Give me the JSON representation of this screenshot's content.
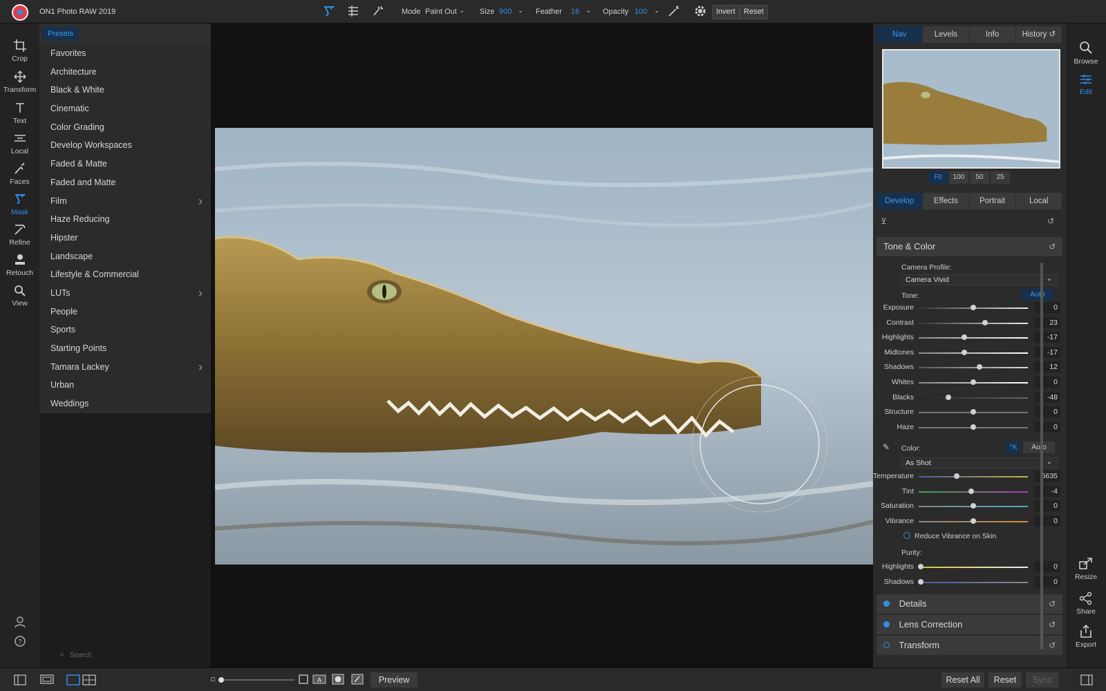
{
  "app": {
    "title": "ON1 Photo RAW 2019"
  },
  "toolbar": {
    "mode_label": "Mode",
    "mode_value": "Paint Out",
    "size_label": "Size",
    "size_value": "900",
    "feather_label": "Feather",
    "feather_value": "16",
    "opacity_label": "Opacity",
    "opacity_value": "100",
    "invert_label": "Invert",
    "reset_label": "Reset"
  },
  "left_tools": [
    {
      "label": "Crop",
      "icon": "crop-icon"
    },
    {
      "label": "Transform",
      "icon": "transform-icon"
    },
    {
      "label": "Text",
      "icon": "text-icon"
    },
    {
      "label": "Local",
      "icon": "local-icon"
    },
    {
      "label": "Faces",
      "icon": "faces-icon"
    },
    {
      "label": "Mask",
      "icon": "mask-icon",
      "active": true
    },
    {
      "label": "Refine",
      "icon": "refine-icon"
    },
    {
      "label": "Retouch",
      "icon": "retouch-icon"
    },
    {
      "label": "View",
      "icon": "view-icon"
    }
  ],
  "presets": {
    "tab_label": "Presets",
    "items": [
      {
        "label": "Favorites"
      },
      {
        "label": "Architecture"
      },
      {
        "label": "Black & White"
      },
      {
        "label": "Cinematic"
      },
      {
        "label": "Color Grading"
      },
      {
        "label": "Develop Workspaces"
      },
      {
        "label": "Faded & Matte"
      },
      {
        "label": "Faded and Matte"
      },
      {
        "label": "Film",
        "submenu": true
      },
      {
        "label": "Haze Reducing"
      },
      {
        "label": "Hipster"
      },
      {
        "label": "Landscape"
      },
      {
        "label": "Lifestyle & Commercial"
      },
      {
        "label": "LUTs",
        "submenu": true
      },
      {
        "label": "People"
      },
      {
        "label": "Sports"
      },
      {
        "label": "Starting Points"
      },
      {
        "label": "Tamara Lackey",
        "submenu": true
      },
      {
        "label": "Urban"
      },
      {
        "label": "Weddings"
      }
    ],
    "search_placeholder": "Search"
  },
  "nav_tabs": [
    "Nav",
    "Levels",
    "Info",
    "History"
  ],
  "zoom_buttons": [
    "Fit",
    "100",
    "50",
    "25"
  ],
  "develop_tabs": [
    "Develop",
    "Effects",
    "Portrait",
    "Local"
  ],
  "tone_color": {
    "title": "Tone & Color",
    "camera_profile_label": "Camera Profile:",
    "camera_profile_value": "Camera Vivid",
    "tone_label": "Tone:",
    "auto_label": "Auto",
    "sliders": [
      {
        "label": "Exposure",
        "value": "0",
        "pos": 0.5
      },
      {
        "label": "Contrast",
        "value": "23",
        "pos": 0.61
      },
      {
        "label": "Highlights",
        "value": "-17",
        "pos": 0.42
      },
      {
        "label": "Midtones",
        "value": "-17",
        "pos": 0.42
      },
      {
        "label": "Shadows",
        "value": "12",
        "pos": 0.56
      },
      {
        "label": "Whites",
        "value": "0",
        "pos": 0.5
      },
      {
        "label": "Blacks",
        "value": "-48",
        "pos": 0.27
      },
      {
        "label": "Structure",
        "value": "0",
        "pos": 0.5
      },
      {
        "label": "Haze",
        "value": "0",
        "pos": 0.5
      }
    ],
    "color_label": "Color:",
    "k_label": "°K",
    "color_auto_label": "Auto",
    "wb_value": "As Shot",
    "color_sliders": [
      {
        "label": "Temperature",
        "value": "5635",
        "pos": 0.35
      },
      {
        "label": "Tint",
        "value": "-4",
        "pos": 0.48
      },
      {
        "label": "Saturation",
        "value": "0",
        "pos": 0.5
      },
      {
        "label": "Vibrance",
        "value": "0",
        "pos": 0.5
      }
    ],
    "reduce_vibrance_label": "Reduce Vibrance on Skin",
    "purity_label": "Purity:",
    "purity_sliders": [
      {
        "label": "Highlights",
        "value": "0",
        "pos": 0.02
      },
      {
        "label": "Shadows",
        "value": "0",
        "pos": 0.02
      }
    ]
  },
  "sections": [
    {
      "title": "Details",
      "dot": "filled"
    },
    {
      "title": "Lens Correction",
      "dot": "filled"
    },
    {
      "title": "Transform",
      "dot": "hollow"
    }
  ],
  "right_modules": [
    {
      "label": "Browse",
      "icon": "browse-icon"
    },
    {
      "label": "Edit",
      "icon": "edit-icon",
      "active": true
    },
    {
      "label": "Resize",
      "icon": "resize-icon"
    },
    {
      "label": "Share",
      "icon": "share-icon"
    },
    {
      "label": "Export",
      "icon": "export-icon"
    }
  ],
  "bottom": {
    "preview_label": "Preview",
    "reset_all_label": "Reset All",
    "reset_label": "Reset",
    "sync_label": "Sync"
  },
  "colors": {
    "accent": "#2f8fe8",
    "panel": "#2b2b2b",
    "dark": "#121212"
  }
}
